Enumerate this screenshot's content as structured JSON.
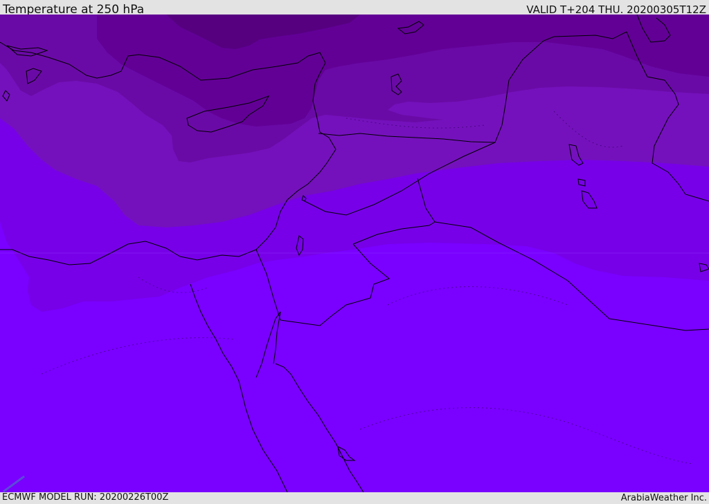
{
  "header": {
    "title": "Temperature at 250 hPa",
    "valid": "VALID T+204 THU. 20200305T12Z"
  },
  "footer": {
    "model_run": "ECMWF MODEL RUN: 20200226T00Z",
    "credit": "ArabiaWeather Inc."
  },
  "map": {
    "colors": {
      "warmest_band": "#7a00ff",
      "band_2": "#7700e8",
      "band_3": "#7411bc",
      "band_4": "#6a0aa6",
      "band_5": "#620096",
      "coldest_band": "#560080",
      "coastline": "#000000",
      "border": "#000000"
    }
  }
}
